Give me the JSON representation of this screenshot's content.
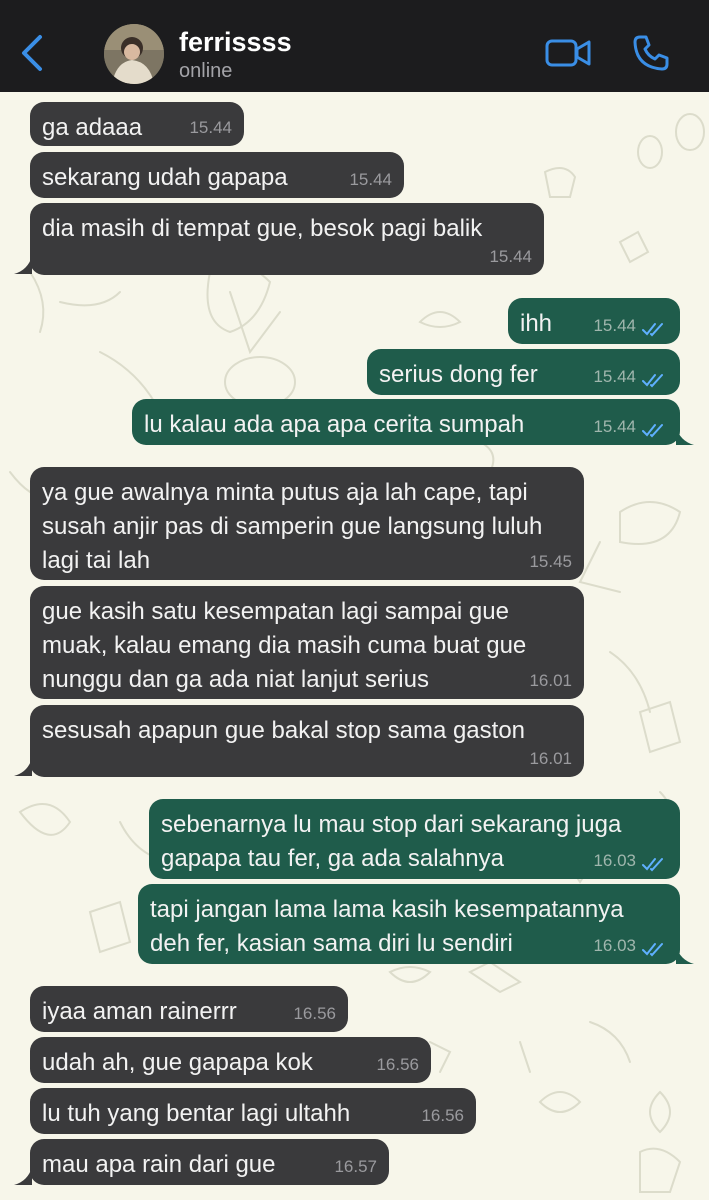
{
  "header": {
    "contact_name": "ferrissss",
    "status": "online",
    "icons": {
      "back": "chevron-left-icon",
      "video": "video-camera-icon",
      "call": "phone-icon"
    },
    "accent_color": "#3a8ee6"
  },
  "theme": {
    "incoming_bubble": "#3a3a3c",
    "outgoing_bubble": "#1f5c4b",
    "wallpaper": "#f7f6ea",
    "read_tick_color": "#5fb0ff"
  },
  "messages": [
    {
      "dir": "in",
      "text": "ga adaaa",
      "time": "15.44"
    },
    {
      "dir": "in",
      "text": "sekarang udah gapapa",
      "time": "15.44"
    },
    {
      "dir": "in",
      "text": "dia masih di tempat gue, besok pagi balik",
      "time": "15.44"
    },
    {
      "dir": "out",
      "text": "ihh",
      "time": "15.44",
      "read": true
    },
    {
      "dir": "out",
      "text": "serius dong fer",
      "time": "15.44",
      "read": true
    },
    {
      "dir": "out",
      "text": "lu kalau ada apa apa cerita sumpah",
      "time": "15.44",
      "read": true
    },
    {
      "dir": "in",
      "text": "ya gue awalnya minta putus aja lah cape, tapi susah anjir pas di samperin gue langsung luluh lagi tai lah",
      "time": "15.45"
    },
    {
      "dir": "in",
      "text": "gue kasih satu kesempatan lagi sampai gue muak, kalau emang dia masih cuma buat gue nunggu dan ga ada niat lanjut serius",
      "time": "16.01"
    },
    {
      "dir": "in",
      "text": "sesusah apapun gue bakal stop sama gaston",
      "time": "16.01"
    },
    {
      "dir": "out",
      "text": "sebenarnya lu mau stop dari sekarang juga gapapa tau fer, ga ada salahnya",
      "time": "16.03",
      "read": true
    },
    {
      "dir": "out",
      "text": "tapi jangan lama lama kasih kesempatannya deh fer, kasian sama diri lu sendiri",
      "time": "16.03",
      "read": true
    },
    {
      "dir": "in",
      "text": "iyaa aman rainerrr",
      "time": "16.56"
    },
    {
      "dir": "in",
      "text": "udah ah, gue gapapa kok",
      "time": "16.56"
    },
    {
      "dir": "in",
      "text": "lu tuh yang bentar lagi ultahh",
      "time": "16.56"
    },
    {
      "dir": "in",
      "text": "mau apa rain dari gue",
      "time": "16.57"
    }
  ]
}
